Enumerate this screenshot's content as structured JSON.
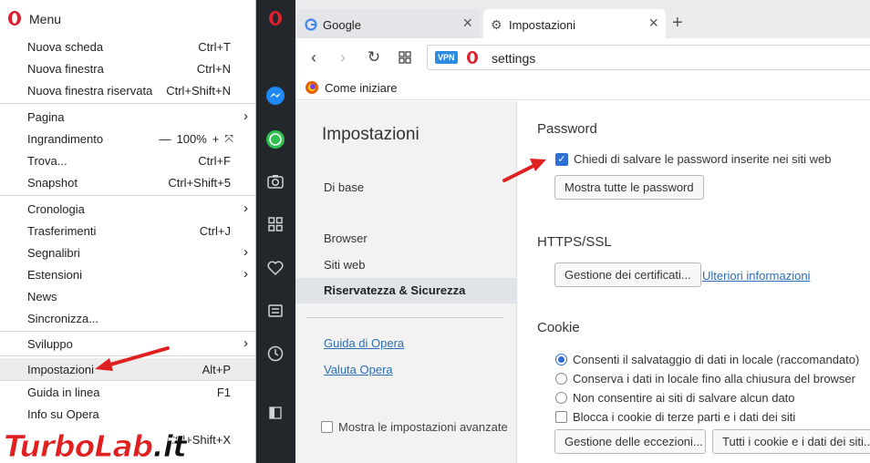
{
  "menu": {
    "title": "Menu",
    "items": [
      {
        "label": "Nuova scheda",
        "shortcut": "Ctrl+T"
      },
      {
        "label": "Nuova finestra",
        "shortcut": "Ctrl+N"
      },
      {
        "label": "Nuova finestra riservata",
        "shortcut": "Ctrl+Shift+N"
      },
      {
        "label": "Pagina",
        "shortcut": ""
      },
      {
        "label": "Ingrandimento",
        "shortcut": ""
      },
      {
        "label": "Trova...",
        "shortcut": "Ctrl+F"
      },
      {
        "label": "Snapshot",
        "shortcut": "Ctrl+Shift+5"
      },
      {
        "label": "Cronologia",
        "shortcut": ""
      },
      {
        "label": "Trasferimenti",
        "shortcut": "Ctrl+J"
      },
      {
        "label": "Segnalibri",
        "shortcut": ""
      },
      {
        "label": "Estensioni",
        "shortcut": ""
      },
      {
        "label": "News",
        "shortcut": ""
      },
      {
        "label": "Sincronizza...",
        "shortcut": ""
      },
      {
        "label": "Sviluppo",
        "shortcut": ""
      },
      {
        "label": "Impostazioni",
        "shortcut": "Alt+P"
      },
      {
        "label": "Guida in linea",
        "shortcut": "F1"
      },
      {
        "label": "Info su Opera",
        "shortcut": ""
      },
      {
        "label": "",
        "shortcut": "Ctrl+Shift+X"
      }
    ],
    "zoom": {
      "minus": "—",
      "value": "100%",
      "plus": "+",
      "fullscreen": "⤧"
    }
  },
  "tabs": [
    {
      "label": "Google",
      "icon": "google-g-icon"
    },
    {
      "label": "Impostazioni",
      "icon": "gear-icon"
    }
  ],
  "address": {
    "vpn": "VPN",
    "url": "settings"
  },
  "bookmarks": [
    {
      "label": "Come iniziare",
      "icon": "firefox-icon"
    }
  ],
  "settings_nav": {
    "heading": "Impostazioni",
    "items": [
      "Di base",
      "Browser",
      "Siti web",
      "Riservatezza & Sicurezza"
    ],
    "links": [
      "Guida di Opera",
      "Valuta Opera"
    ],
    "advanced": "Mostra le impostazioni avanzate"
  },
  "password": {
    "title": "Password",
    "checkbox": "Chiedi di salvare le password inserite nei siti web",
    "button": "Mostra tutte le password"
  },
  "https": {
    "title": "HTTPS/SSL",
    "button": "Gestione dei certificati...",
    "link": "Ulteriori informazioni"
  },
  "cookie": {
    "title": "Cookie",
    "options": [
      "Consenti il salvataggio di dati in locale (raccomandato)",
      "Conserva i dati in locale fino alla chiusura del browser",
      "Non consentire ai siti di salvare alcun dato"
    ],
    "checkbox": "Blocca i cookie di terze parti e i dati dei siti",
    "buttons": [
      "Gestione delle eccezioni...",
      "Tutti i cookie e i dati dei siti..."
    ]
  },
  "watermark": {
    "part1": "Turbo",
    "part2": "Lab",
    "part3": ".it"
  },
  "colors": {
    "accent": "#2d6fd6",
    "opera_red": "#e0202c",
    "sidebar": "#23272c",
    "arrow": "#e02020"
  }
}
